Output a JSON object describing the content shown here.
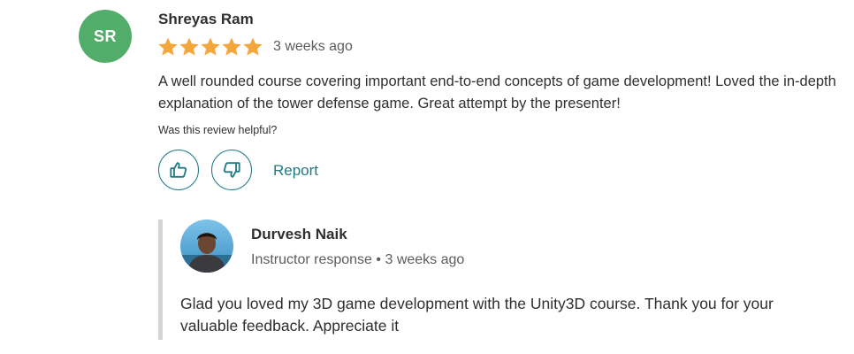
{
  "review": {
    "avatar_initials": "SR",
    "avatar_color": "#52ad6a",
    "reviewer_name": "Shreyas Ram",
    "rating": 5,
    "rating_max": 5,
    "star_color": "#f3a63b",
    "time": "3 weeks ago",
    "body": "A well rounded course covering important end-to-end concepts of game development! Loved the in-depth explanation of the tower defense game. Great attempt by the presenter!",
    "helpful_question": "Was this review helpful?",
    "thumbs_up_icon": "thumbs-up-icon",
    "thumbs_down_icon": "thumbs-down-icon",
    "report_label": "Report",
    "accent_color": "#1f7a86"
  },
  "response": {
    "instructor_name": "Durvesh Naik",
    "role_label": "Instructor response",
    "separator": "•",
    "time": "3 weeks ago",
    "body": "Glad you loved my 3D game development with the Unity3D course. Thank you for your valuable feedback. Appreciate it",
    "border_color": "#d5d4d0"
  }
}
